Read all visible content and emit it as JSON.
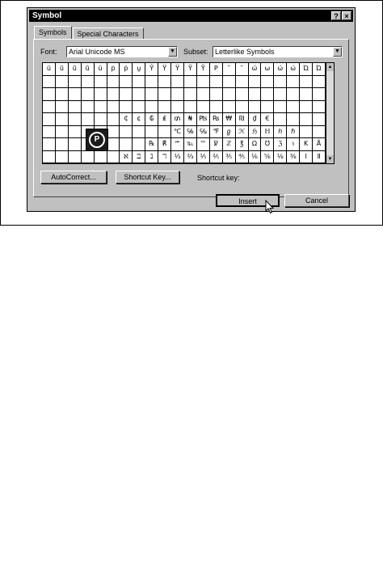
{
  "window": {
    "title": "Symbol"
  },
  "titlebar": {
    "help": "?",
    "close": "×"
  },
  "tabs": [
    "Symbols",
    "Special Characters"
  ],
  "font": {
    "label": "Font:",
    "value": "Arial Unicode MS"
  },
  "subset": {
    "label": "Subset:",
    "value": "Letterlike Symbols"
  },
  "scroll": {
    "up": "▲",
    "down": "▼"
  },
  "grid": {
    "rows": [
      [
        "ŭ",
        "ū",
        "ũ",
        "ũ",
        "ŭ",
        "ṗ",
        "ṗ",
        "ṵ",
        "Ŷ",
        "Ÿ",
        "Ÿ",
        "Ỹ",
        "Ỹ",
        "P",
        "˜",
        "˜",
        "ώ",
        "ω",
        "ώ",
        "ώ",
        "Ώ",
        "Ώ"
      ],
      [
        "",
        "",
        "",
        "",
        "",
        "",
        "",
        "",
        "",
        "",
        "",
        "",
        "",
        "",
        "",
        "",
        "",
        "",
        "",
        "",
        "",
        ""
      ],
      [
        "",
        "",
        "",
        "",
        "",
        "",
        "",
        "",
        "",
        "",
        "",
        "",
        "",
        "",
        "",
        "",
        "",
        "",
        "",
        "",
        "",
        ""
      ],
      [
        "",
        "",
        "",
        "",
        "",
        "",
        "",
        "",
        "",
        "",
        "",
        "",
        "",
        "",
        "",
        "",
        "",
        "",
        "",
        "",
        "",
        ""
      ],
      [
        "",
        "",
        "",
        "",
        "",
        "",
        "₵",
        "¢",
        "₲",
        "₤",
        "₥",
        "₦",
        "₧",
        "₨",
        "₩",
        "₪",
        "₫",
        "€",
        "",
        "",
        "",
        ""
      ],
      [
        "",
        "",
        "",
        "",
        "",
        "",
        "",
        "",
        "",
        "",
        "℃",
        "℅",
        "℆",
        "℉",
        "ℊ",
        "ℋ",
        "ℌ",
        "ℍ",
        "ℎ",
        "ℏ",
        "",
        ""
      ],
      [
        "",
        "",
        "",
        "",
        "",
        "",
        "",
        "",
        "℞",
        "℟",
        "℠",
        "℡",
        "™",
        "℣",
        "ℤ",
        "℥",
        "Ω",
        "℧",
        "ℨ",
        "℩",
        "K",
        "Å"
      ],
      [
        "",
        "",
        "",
        "",
        "",
        "",
        "ℵ",
        "ℶ",
        "ℷ",
        "ℸ",
        "⅓",
        "⅔",
        "⅕",
        "⅖",
        "⅗",
        "⅘",
        "⅙",
        "⅚",
        "⅛",
        "⅜",
        "Ⅰ",
        "Ⅱ"
      ]
    ]
  },
  "zoom": {
    "glyph": "P"
  },
  "buttons": {
    "autocorrect": "AutoCorrect...",
    "shortcut": "Shortcut Key...",
    "shortcut_label": "Shortcut key:",
    "insert": "Insert",
    "cancel": "Cancel"
  },
  "icons": {
    "cursor": "pointer-arrow-icon",
    "zoom": "registered-p-icon"
  }
}
